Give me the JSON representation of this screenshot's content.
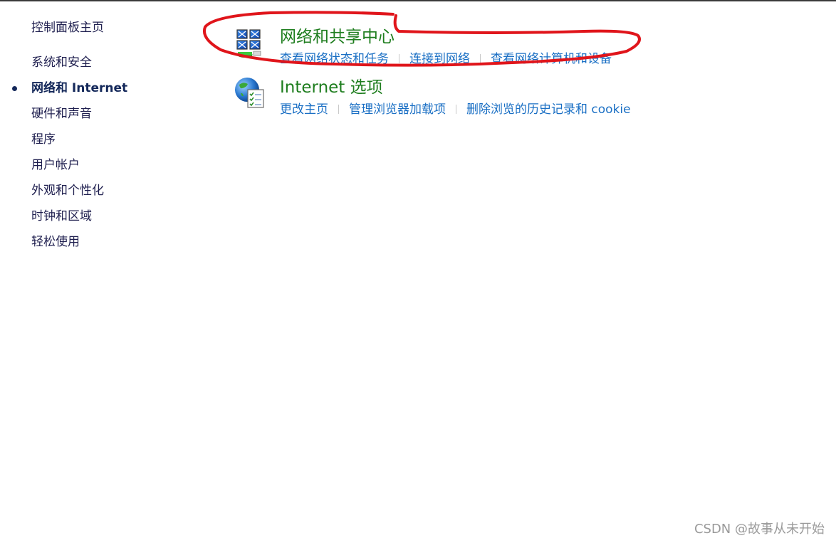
{
  "sidebar": {
    "home": "控制面板主页",
    "items": [
      {
        "label": "系统和安全",
        "active": false
      },
      {
        "label": "网络和 Internet",
        "active": true
      },
      {
        "label": "硬件和声音",
        "active": false
      },
      {
        "label": "程序",
        "active": false
      },
      {
        "label": "用户帐户",
        "active": false
      },
      {
        "label": "外观和个性化",
        "active": false
      },
      {
        "label": "时钟和区域",
        "active": false
      },
      {
        "label": "轻松使用",
        "active": false
      }
    ]
  },
  "main": {
    "categories": [
      {
        "title": "网络和共享中心",
        "icon": "network-sharing-icon",
        "links": [
          "查看网络状态和任务",
          "连接到网络",
          "查看网络计算机和设备"
        ]
      },
      {
        "title": "Internet 选项",
        "icon": "internet-options-globe-icon",
        "links": [
          "更改主页",
          "管理浏览器加载项",
          "删除浏览的历史记录和 cookie"
        ]
      }
    ]
  },
  "annotation": {
    "color": "#e0151b"
  },
  "watermark": "CSDN @故事从未开始",
  "colors": {
    "category_title": "#1e7d1e",
    "link": "#1a6fc4",
    "sidebar_text": "#1f1f4f"
  }
}
